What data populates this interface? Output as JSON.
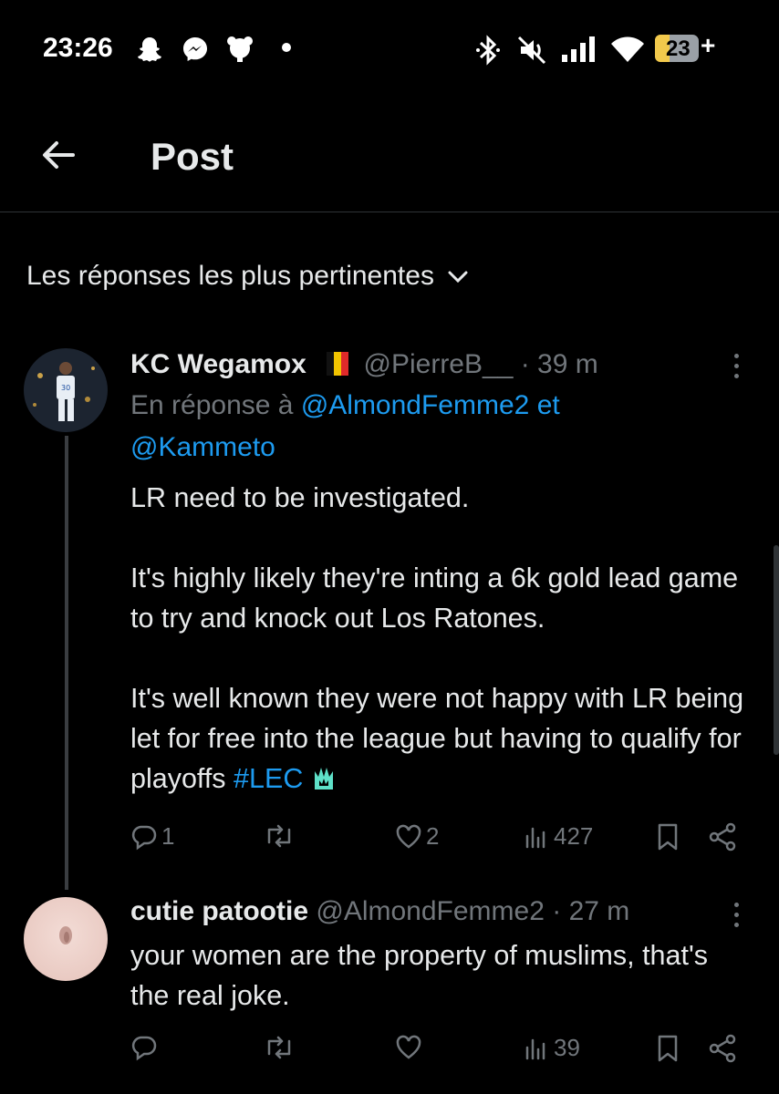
{
  "status_bar": {
    "time": "23:26",
    "battery": "23",
    "charging": "+",
    "icons": [
      "snapchat-icon",
      "messenger-icon",
      "notification-icon",
      "dot-icon",
      "bluetooth-icon",
      "mute-icon",
      "signal-icon",
      "wifi-icon",
      "battery-icon"
    ]
  },
  "header": {
    "title": "Post"
  },
  "sort": {
    "label": "Les réponses les plus pertinentes"
  },
  "reply1": {
    "name": "KC Wegamox",
    "handle": "@PierreB__",
    "time": "· 39 m",
    "reply_prefix": "En réponse à",
    "mention1": "@AlmondFemme2",
    "conj": "et",
    "mention2": "@Kammeto",
    "text_p1": "LR need to be investigated.",
    "text_p2": "It's highly likely they're inting a 6k gold lead game to try and knock out Los Ratones.",
    "text_p3a": "It's well known they were not happy with LR being let for free into the league but having to qualify for playoffs ",
    "hashtag": "#LEC",
    "replies": "1",
    "reposts": "",
    "likes": "2",
    "views": "427"
  },
  "reply2": {
    "name": "cutie patootie",
    "handle": "@AlmondFemme2",
    "time": "· 27 m",
    "text": "your women are the property of muslims, that's the real joke.",
    "replies": "",
    "reposts": "",
    "likes": "",
    "views": "39"
  },
  "colors": {
    "background": "#000000",
    "text": "#e7e9ea",
    "muted": "#71767b",
    "link": "#1d9bf0"
  }
}
